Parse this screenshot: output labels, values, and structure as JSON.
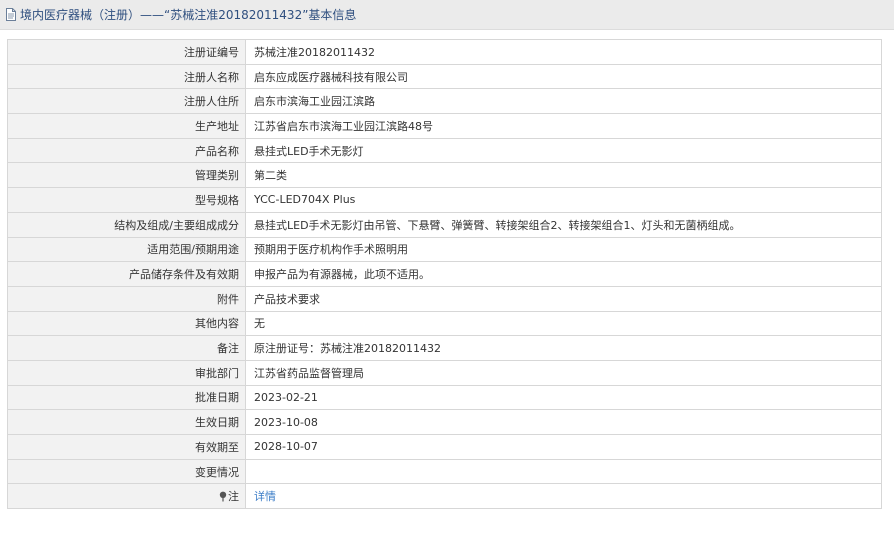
{
  "header": {
    "icon": "document-icon",
    "title": "境内医疗器械（注册）——“苏械注准20182011432”基本信息"
  },
  "rows": [
    {
      "label": "注册证编号",
      "value": "苏械注准20182011432"
    },
    {
      "label": "注册人名称",
      "value": "启东应成医疗器械科技有限公司"
    },
    {
      "label": "注册人住所",
      "value": "启东市滨海工业园江滨路"
    },
    {
      "label": "生产地址",
      "value": "江苏省启东市滨海工业园江滨路48号"
    },
    {
      "label": "产品名称",
      "value": "悬挂式LED手术无影灯"
    },
    {
      "label": "管理类别",
      "value": "第二类"
    },
    {
      "label": "型号规格",
      "value": "YCC-LED704X Plus"
    },
    {
      "label": "结构及组成/主要组成成分",
      "value": "悬挂式LED手术无影灯由吊管、下悬臂、弹簧臂、转接架组合2、转接架组合1、灯头和无菌柄组成。"
    },
    {
      "label": "适用范围/预期用途",
      "value": "预期用于医疗机构作手术照明用"
    },
    {
      "label": "产品储存条件及有效期",
      "value": "申报产品为有源器械，此项不适用。"
    },
    {
      "label": "附件",
      "value": "产品技术要求"
    },
    {
      "label": "其他内容",
      "value": "无"
    },
    {
      "label": "备注",
      "value": "原注册证号：苏械注准20182011432"
    },
    {
      "label": "审批部门",
      "value": "江苏省药品监督管理局"
    },
    {
      "label": "批准日期",
      "value": "2023-02-21"
    },
    {
      "label": "生效日期",
      "value": "2023-10-08"
    },
    {
      "label": "有效期至",
      "value": "2028-10-07"
    },
    {
      "label": "变更情况",
      "value": ""
    }
  ],
  "note_row": {
    "icon": "pin-icon",
    "label": "注",
    "link_text": "详情"
  },
  "colors": {
    "title_text": "#2f4f7f",
    "label_bg": "#f2f2f2",
    "border": "#d7d7d7",
    "link": "#3a7cc7"
  }
}
